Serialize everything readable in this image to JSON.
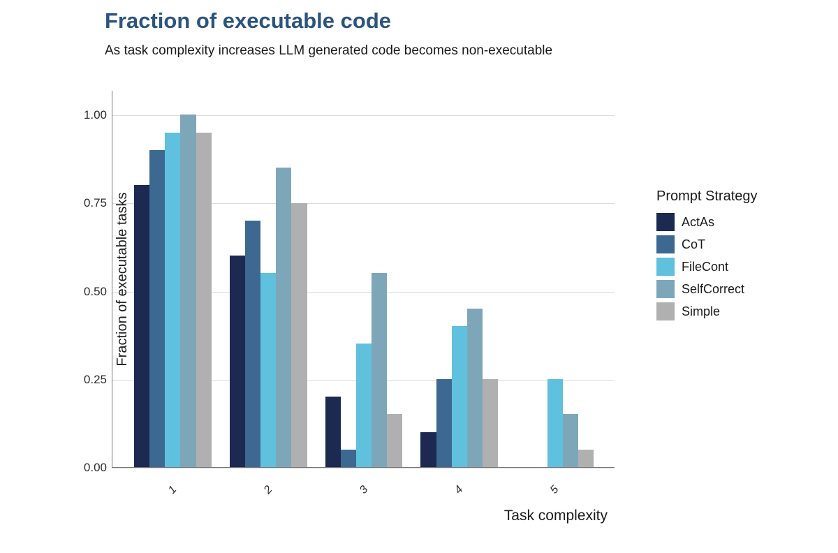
{
  "title": "Fraction of executable code",
  "subtitle": "As task complexity increases LLM generated code becomes non-executable",
  "xlabel": "Task complexity",
  "ylabel": "Fraction of executable tasks",
  "legend_title": "Prompt Strategy",
  "y_ticks": [
    "0.00",
    "0.25",
    "0.50",
    "0.75",
    "1.00"
  ],
  "x_ticks": [
    "1",
    "2",
    "3",
    "4",
    "5"
  ],
  "colors": {
    "ActAs": "#1c2a52",
    "CoT": "#3c6891",
    "FileCont": "#5fc1de",
    "SelfCorrect": "#7da7b8",
    "Simple": "#b0b0b0"
  },
  "series_order": [
    "ActAs",
    "CoT",
    "FileCont",
    "SelfCorrect",
    "Simple"
  ],
  "legend_labels": {
    "ActAs": "ActAs",
    "CoT": "CoT",
    "FileCont": "FileCont",
    "SelfCorrect": "SelfCorrect",
    "Simple": "Simple"
  },
  "chart_data": {
    "type": "bar",
    "title": "Fraction of executable code",
    "subtitle": "As task complexity increases LLM generated code becomes non-executable",
    "xlabel": "Task complexity",
    "ylabel": "Fraction of executable tasks",
    "ylim": [
      0,
      1.07
    ],
    "categories": [
      "1",
      "2",
      "3",
      "4",
      "5"
    ],
    "series": [
      {
        "name": "ActAs",
        "values": [
          0.8,
          0.6,
          0.2,
          0.1,
          0.0
        ]
      },
      {
        "name": "CoT",
        "values": [
          0.9,
          0.7,
          0.05,
          0.25,
          0.0
        ]
      },
      {
        "name": "FileCont",
        "values": [
          0.95,
          0.55,
          0.35,
          0.4,
          0.25
        ]
      },
      {
        "name": "SelfCorrect",
        "values": [
          1.0,
          0.85,
          0.55,
          0.45,
          0.15
        ]
      },
      {
        "name": "Simple",
        "values": [
          0.95,
          0.75,
          0.15,
          0.25,
          0.05
        ]
      }
    ]
  }
}
